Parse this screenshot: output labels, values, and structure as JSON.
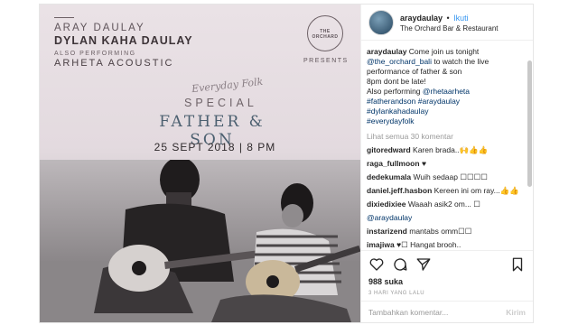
{
  "poster": {
    "line1": "ARAY DAULAY",
    "line2": "DYLAN KAHA DAULAY",
    "line3": "ALSO PERFORMING",
    "line4": "ARHETA ACOUSTIC",
    "logo_text": "THE ORCHARD",
    "presents": "PRESENTS",
    "script": "Everyday Folk",
    "special": "SPECIAL",
    "title": "FATHER & SON",
    "date": "25 SEPT 2018 | 8 PM"
  },
  "header": {
    "username": "araydaulay",
    "separator": "•",
    "follow_label": "Ikuti",
    "location": "The Orchard Bar & Restaurant"
  },
  "caption": {
    "username": "araydaulay",
    "text1": "Come join us tonight",
    "mention1": "@the_orchard_bali",
    "text2": "to watch the live performance of father & son",
    "text3": "8pm dont be late!",
    "text4": "Also performing",
    "mention2": "@rhetaarheta",
    "tag1": "#fatherandson",
    "tag2": "#araydaulay",
    "tag3": "#dylankahadaulay",
    "tag4": "#everydayfolk"
  },
  "view_more": "Lihat semua 30 komentar",
  "comments": [
    {
      "user": "gitoredward",
      "text": "Karen brada..🙌👍👍"
    },
    {
      "user": "raga_fullmoon",
      "text": "♥"
    },
    {
      "user": "dedekumala",
      "text": "Wuih sedaap ☐☐☐☐"
    },
    {
      "user": "daniel.jeff.hasbon",
      "text": "Kereen ini om ray...👍👍"
    },
    {
      "user": "dixiedixiee",
      "text": "Waaah asik2 om... ☐"
    },
    {
      "user": "",
      "text": "@araydaulay"
    },
    {
      "user": "instarizend",
      "text": "mantabs omm☐☐"
    },
    {
      "user": "imajiwa",
      "text": "♥☐ Hangat brooh.."
    }
  ],
  "likes": "988 suka",
  "time_ago": "3 HARI YANG LALU",
  "add_comment_placeholder": "Tambahkan komentar...",
  "post_label": "Kirim",
  "colors": {
    "link": "#003569",
    "follow": "#3897f0",
    "muted": "#999999"
  }
}
